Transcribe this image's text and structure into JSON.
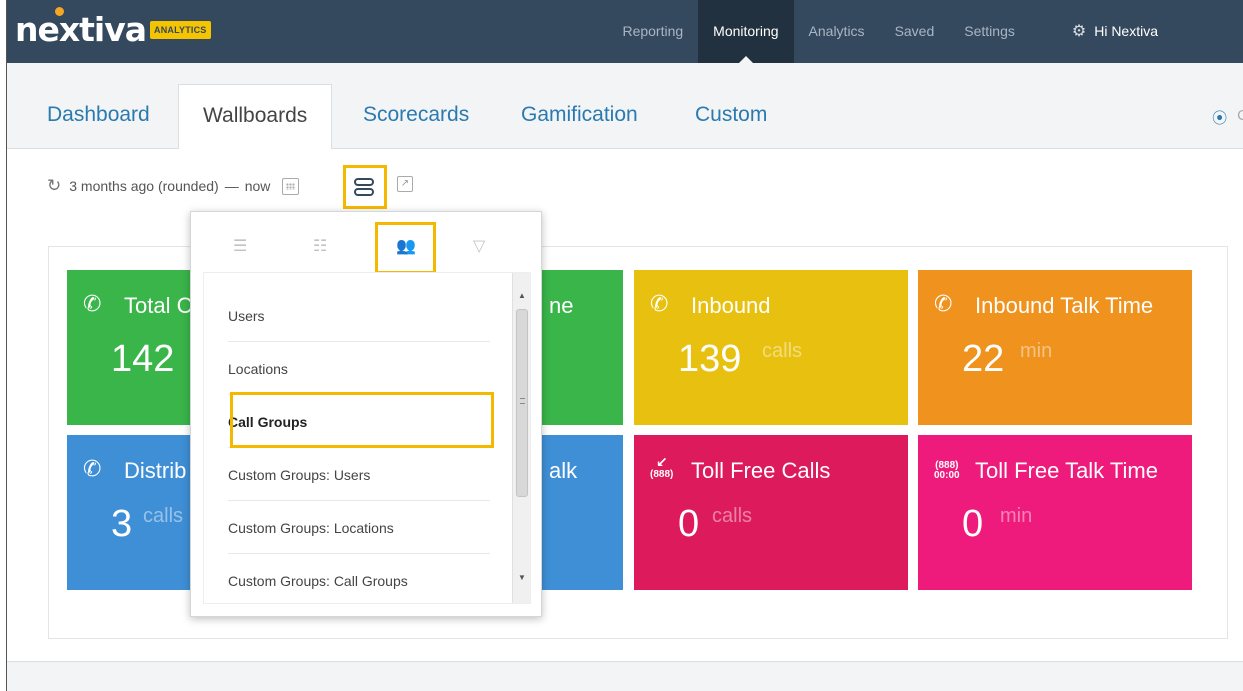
{
  "brand": {
    "name": "nextiva",
    "badge": "ANALYTICS"
  },
  "nav": {
    "items": [
      {
        "label": "Reporting",
        "active": false
      },
      {
        "label": "Monitoring",
        "active": true
      },
      {
        "label": "Analytics",
        "active": false
      },
      {
        "label": "Saved",
        "active": false
      },
      {
        "label": "Settings",
        "active": false
      }
    ],
    "user_greeting": "Hi Nextiva"
  },
  "tabs": [
    {
      "label": "Dashboard"
    },
    {
      "label": "Wallboards"
    },
    {
      "label": "Scorecards"
    },
    {
      "label": "Gamification"
    },
    {
      "label": "Custom"
    }
  ],
  "toolbar": {
    "range_text": "3 months ago (rounded)",
    "dash": "—",
    "now": "now"
  },
  "tiles": [
    {
      "title": "Total C",
      "value": "142",
      "unit": "",
      "color": "#3ab54a",
      "icon": "phone-sum-icon"
    },
    {
      "title": "ne",
      "value": "",
      "unit": "",
      "color": "#3ab54a",
      "icon": ""
    },
    {
      "title": "Inbound",
      "value": "139",
      "unit": "calls",
      "color": "#e8c00f",
      "icon": "phone-incoming-icon"
    },
    {
      "title": "Inbound Talk Time",
      "value": "22",
      "unit": "min",
      "color": "#f0921e",
      "icon": "phone-incoming-timer-icon"
    },
    {
      "title": "Distrib",
      "value": "3",
      "unit": "calls",
      "color": "#3f8fd6",
      "icon": "phone-outgoing-icon"
    },
    {
      "title": "alk",
      "value": "",
      "unit": "",
      "color": "#3f8fd6",
      "icon": ""
    },
    {
      "title": "Toll Free Calls",
      "value": "0",
      "unit": "calls",
      "color": "#dc1a5c",
      "icon": "toll-free-icon",
      "icon_text": "(888)"
    },
    {
      "title": "Toll Free Talk Time",
      "value": "0",
      "unit": "min",
      "color": "#ee1b7c",
      "icon": "toll-free-timer-icon",
      "icon_text_top": "(888)",
      "icon_text_bottom": "00:00"
    }
  ],
  "dropdown": {
    "items": [
      {
        "label": "Users"
      },
      {
        "label": "Locations"
      },
      {
        "label": "Call Groups",
        "selected": true
      },
      {
        "label": "Custom Groups: Users"
      },
      {
        "label": "Custom Groups: Locations"
      },
      {
        "label": "Custom Groups: Call Groups"
      }
    ]
  },
  "colors": {
    "topbar": "#34495e",
    "highlight": "#f5b800",
    "link": "#2a7ab0"
  }
}
